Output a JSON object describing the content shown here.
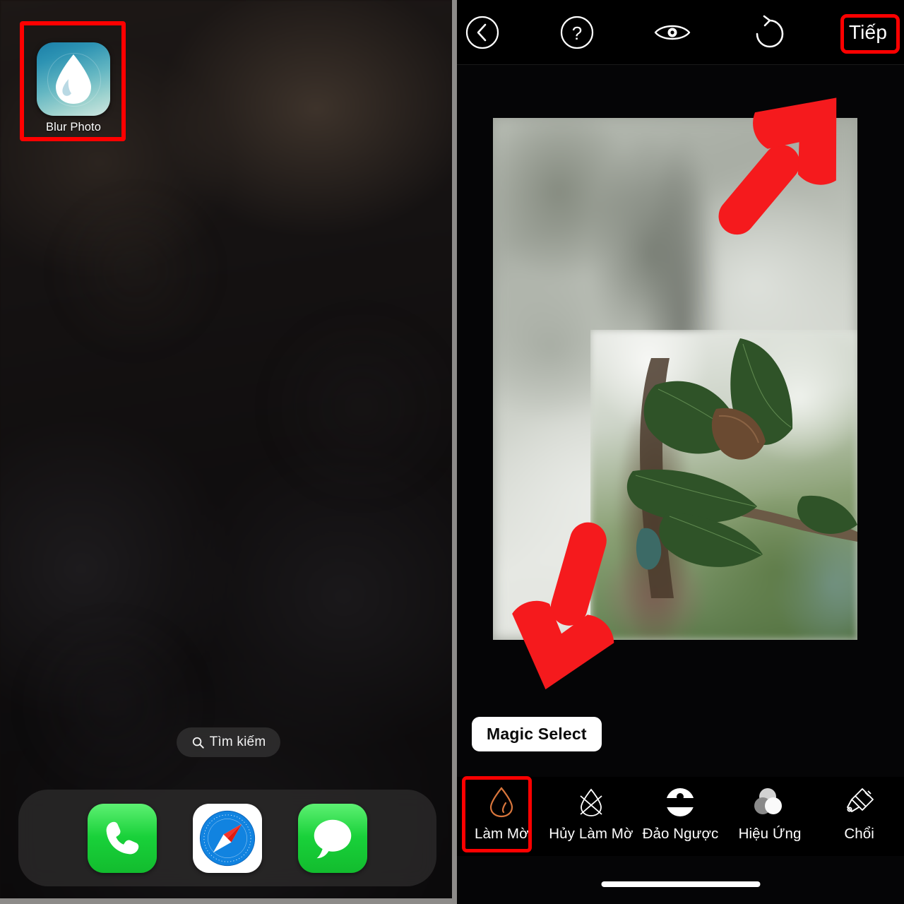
{
  "home_screen": {
    "app": {
      "label": "Blur Photo",
      "icon": "water-droplet-icon",
      "highlight_color": "#ff0000"
    },
    "search": {
      "label": "Tìm kiếm",
      "icon": "search-icon"
    },
    "dock": {
      "items": [
        {
          "name": "phone",
          "icon": "phone-icon",
          "color": "#19d13a"
        },
        {
          "name": "safari",
          "icon": "safari-compass-icon",
          "color": "#1e7fe0"
        },
        {
          "name": "messages",
          "icon": "messages-bubble-icon",
          "color": "#19d13a"
        }
      ]
    }
  },
  "editor": {
    "topbar": {
      "back": "back-chevron-icon",
      "help": "question-mark-icon",
      "preview": "eye-icon",
      "undo": "undo-rotate-icon",
      "next_label": "Tiếp",
      "next_highlight_color": "#ff0000"
    },
    "canvas": {
      "tooltip_label": "Magic Select",
      "photo_description": "Blurred photo of a plant branch with green leaves"
    },
    "toolbar": {
      "items": [
        {
          "label": "Làm Mờ",
          "icon": "droplet-outline-icon",
          "active": true
        },
        {
          "label": "Hủy Làm Mờ",
          "icon": "droplet-crossed-out-icon",
          "active": false
        },
        {
          "label": "Đảo Ngược",
          "icon": "invert-contrast-circle-icon",
          "active": false
        },
        {
          "label": "Hiệu Ứng",
          "icon": "overlapping-circles-icon",
          "active": false
        },
        {
          "label": "Chổi",
          "icon": "paintbrush-icon",
          "active": false
        }
      ],
      "active_highlight_color": "#ff0000"
    },
    "annotations": [
      {
        "name": "arrow-to-next-button",
        "direction": "up-right",
        "color": "#ff1111"
      },
      {
        "name": "arrow-to-blur-tool",
        "direction": "down-left",
        "color": "#ff1111"
      }
    ]
  }
}
